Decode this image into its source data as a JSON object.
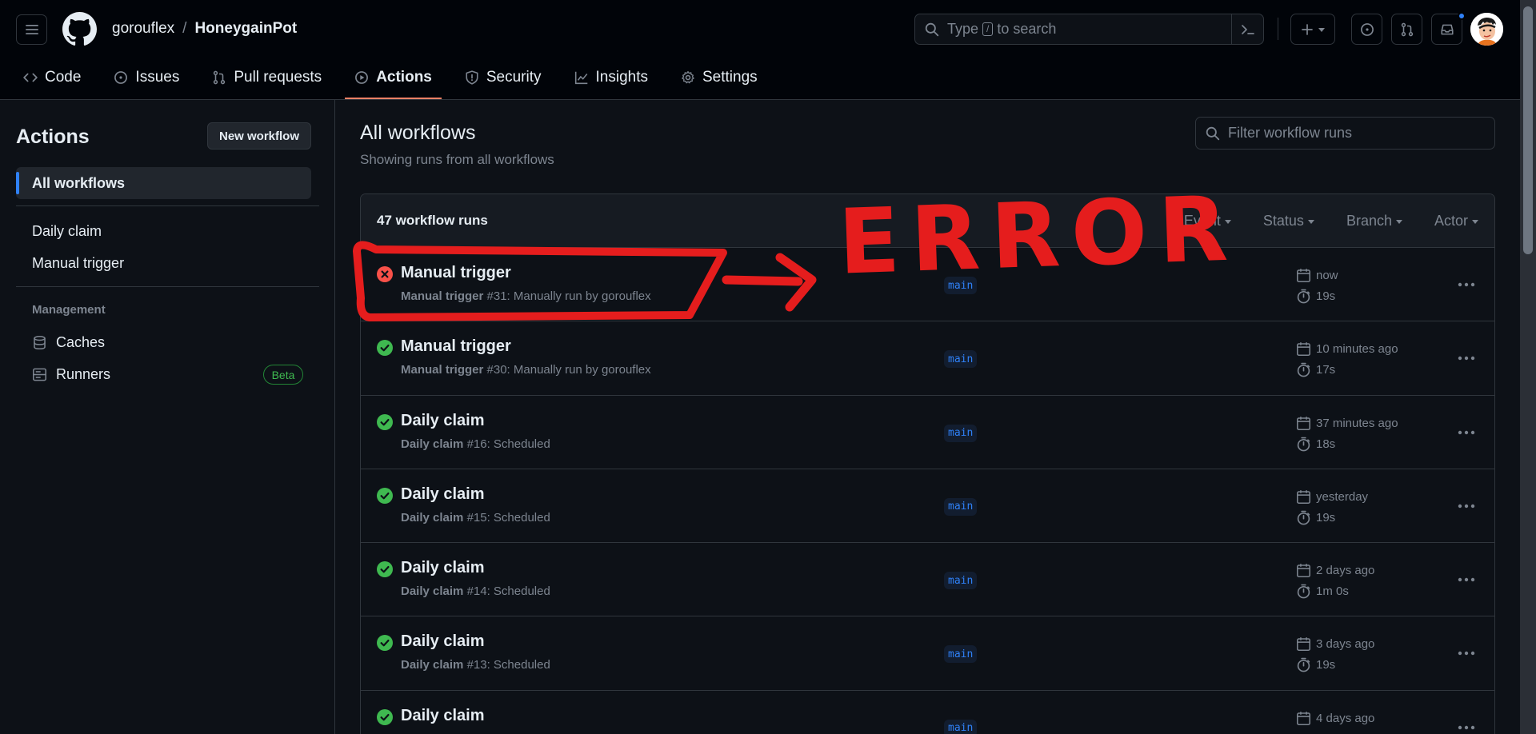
{
  "header": {
    "owner": "gorouflex",
    "separator": "/",
    "repo": "HoneygainPot",
    "search_prefix": "Type",
    "search_key": "/",
    "search_suffix": "to search",
    "new_label": "+"
  },
  "nav": {
    "tabs": [
      {
        "label": "Code",
        "icon": "code-icon"
      },
      {
        "label": "Issues",
        "icon": "issue-icon"
      },
      {
        "label": "Pull requests",
        "icon": "pull-request-icon"
      },
      {
        "label": "Actions",
        "icon": "play-icon",
        "active": true
      },
      {
        "label": "Security",
        "icon": "shield-icon"
      },
      {
        "label": "Insights",
        "icon": "graph-icon"
      },
      {
        "label": "Settings",
        "icon": "gear-icon"
      }
    ]
  },
  "sidebar": {
    "title": "Actions",
    "new_workflow": "New workflow",
    "all_workflows": "All workflows",
    "workflows": [
      "Daily claim",
      "Manual trigger"
    ],
    "management_heading": "Management",
    "caches": "Caches",
    "runners": "Runners",
    "beta": "Beta"
  },
  "main": {
    "title": "All workflows",
    "subtitle": "Showing runs from all workflows",
    "filter_placeholder": "Filter workflow runs",
    "runs_count": "47 workflow runs",
    "filters": [
      "Event",
      "Status",
      "Branch",
      "Actor"
    ]
  },
  "runs": [
    {
      "status": "failure",
      "title": "Manual trigger",
      "workflow": "Manual trigger",
      "detail": "#31: Manually run by gorouflex",
      "branch": "main",
      "when": "now",
      "duration": "19s"
    },
    {
      "status": "success",
      "title": "Manual trigger",
      "workflow": "Manual trigger",
      "detail": "#30: Manually run by gorouflex",
      "branch": "main",
      "when": "10 minutes ago",
      "duration": "17s"
    },
    {
      "status": "success",
      "title": "Daily claim",
      "workflow": "Daily claim",
      "detail": "#16: Scheduled",
      "branch": "main",
      "when": "37 minutes ago",
      "duration": "18s"
    },
    {
      "status": "success",
      "title": "Daily claim",
      "workflow": "Daily claim",
      "detail": "#15: Scheduled",
      "branch": "main",
      "when": "yesterday",
      "duration": "19s"
    },
    {
      "status": "success",
      "title": "Daily claim",
      "workflow": "Daily claim",
      "detail": "#14: Scheduled",
      "branch": "main",
      "when": "2 days ago",
      "duration": "1m 0s"
    },
    {
      "status": "success",
      "title": "Daily claim",
      "workflow": "Daily claim",
      "detail": "#13: Scheduled",
      "branch": "main",
      "when": "3 days ago",
      "duration": "19s"
    },
    {
      "status": "success",
      "title": "Daily claim",
      "workflow": "",
      "detail": "",
      "branch": "main",
      "when": "4 days ago",
      "duration": ""
    }
  ],
  "annotation": {
    "text": "ERROR",
    "color": "#e51d1d"
  },
  "colors": {
    "accent": "#2f81f7",
    "success": "#3fb950",
    "failure": "#f85149",
    "active_tab_underline": "#f78166"
  }
}
